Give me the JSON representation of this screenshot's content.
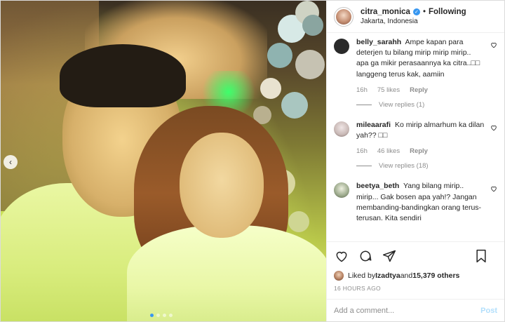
{
  "header": {
    "username": "citra_monica",
    "separator": "•",
    "follow_state": "Following",
    "location": "Jakarta, Indonesia"
  },
  "comments": [
    {
      "user": "belly_sarahh",
      "text": "Ampe kapan para deterjen tu bilang mirip mirip mirip.. apa ga mikir perasaannya ka citra..□□ langgeng terus kak, aamiin",
      "time": "16h",
      "likes": "75 likes",
      "reply_label": "Reply",
      "view_replies": "View replies (1)",
      "avatar_color": "#2a2a2a"
    },
    {
      "user": "mileaarafi",
      "text": "Ko mirip almarhum ka dilan yah?? □□",
      "time": "16h",
      "likes": "46 likes",
      "reply_label": "Reply",
      "view_replies": "View replies (18)",
      "avatar_color": "#c9b9b6"
    },
    {
      "user": "beetya_beth",
      "text": "Yang bilang mirip.. mirip... Gak bosen apa yah!? Jangan membanding-bandingkan orang terus-terusan. Kita sendiri",
      "avatar_color": "#9aa88a"
    }
  ],
  "likes": {
    "prefix": "Liked by ",
    "user": "Izadtya",
    "middle": " and ",
    "count": "15,379 others"
  },
  "timestamp": "16 HOURS AGO",
  "add_comment": {
    "placeholder": "Add a comment...",
    "post_label": "Post"
  },
  "colors": {
    "accent": "#3897f0",
    "post_disabled": "#b2dffc",
    "meta_gray": "#8e8e8e"
  },
  "icons": [
    "chevron-left-icon",
    "verified-badge-icon",
    "heart-icon",
    "comment-icon",
    "share-icon",
    "bookmark-icon"
  ],
  "carousel": {
    "dots": 4,
    "active_index": 0
  }
}
